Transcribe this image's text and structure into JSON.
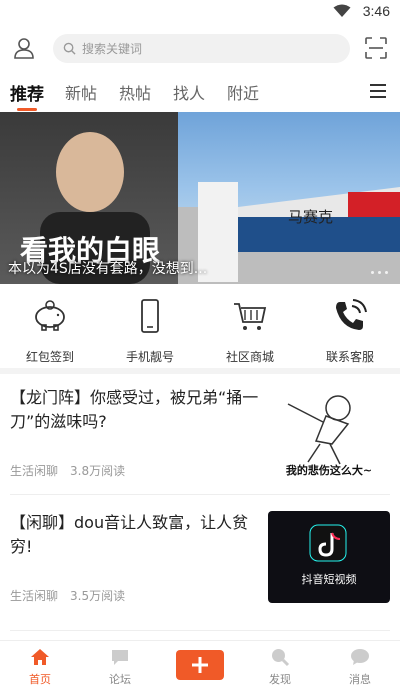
{
  "status_bar": {
    "time": "3:46",
    "icons": [
      "wifi-icon",
      "battery-icon"
    ]
  },
  "search": {
    "placeholder": "搜索关键词"
  },
  "tabs": [
    {
      "label": "推荐",
      "active": true
    },
    {
      "label": "新帖"
    },
    {
      "label": "热帖"
    },
    {
      "label": "找人"
    },
    {
      "label": "附近"
    }
  ],
  "banner": {
    "caption": "本以为4S店没有套路，没想到...",
    "left_image_text": "看我的白眼",
    "right_image_text": "马赛克"
  },
  "shortcuts": [
    {
      "label": "红包签到",
      "icon": "piggy-bank-icon"
    },
    {
      "label": "手机靓号",
      "icon": "phone-icon"
    },
    {
      "label": "社区商城",
      "icon": "cart-icon"
    },
    {
      "label": "联系客服",
      "icon": "phone-call-icon"
    }
  ],
  "posts": [
    {
      "title": "【龙门阵】你感受过，被兄弟“捅一刀”的滋味吗?",
      "category": "生活闲聊",
      "reads": "3.8万阅读",
      "thumb_text": "我的悲伤这么大~"
    },
    {
      "title": "【闲聊】dou音让人致富，让人贫穷!",
      "category": "生活闲聊",
      "reads": "3.5万阅读",
      "thumb_text": "抖音短视频"
    }
  ],
  "bottom_nav": [
    {
      "label": "首页",
      "icon": "home-icon",
      "active": true
    },
    {
      "label": "论坛",
      "icon": "forum-icon"
    },
    {
      "label": "",
      "icon": "plus-icon"
    },
    {
      "label": "发现",
      "icon": "discover-icon"
    },
    {
      "label": "消息",
      "icon": "message-icon"
    }
  ],
  "colors": {
    "accent": "#f05a28",
    "muted": "#999999"
  }
}
